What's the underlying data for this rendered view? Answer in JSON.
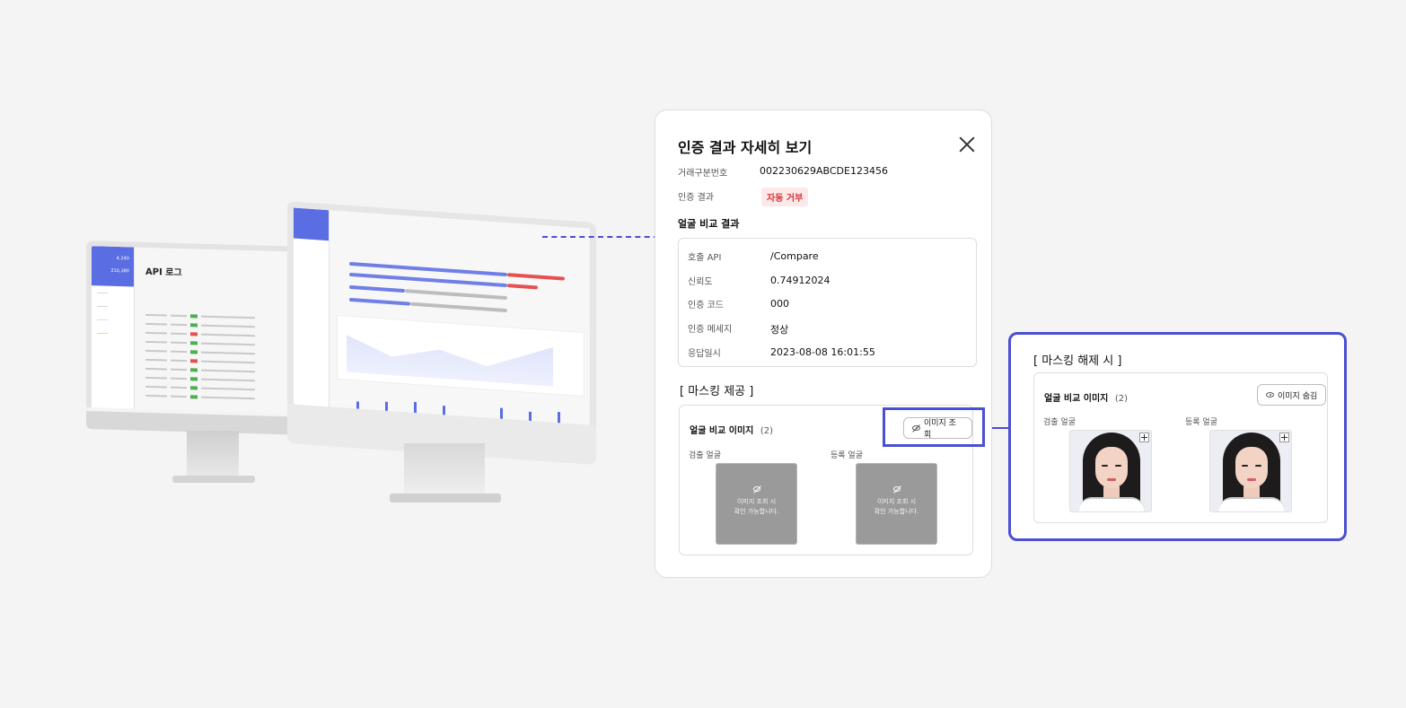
{
  "back_screen": {
    "title": "API 로그",
    "side_card": "4,240",
    "side_amount": "210,380"
  },
  "panel": {
    "title": "인증 결과 자세히 보기",
    "fields": [
      {
        "label": "거래구분번호",
        "value": "002230629ABCDE123456"
      },
      {
        "label": "인증 결과",
        "value": "자동 거부"
      }
    ],
    "face_result": {
      "title": "얼굴 비교 결과",
      "rows": [
        {
          "label": "호출 API",
          "value": "/Compare"
        },
        {
          "label": "신뢰도",
          "value": "0.74912024"
        },
        {
          "label": "인증 코드",
          "value": "000"
        },
        {
          "label": "인증 메세지",
          "value": "정상"
        },
        {
          "label": "응답일시",
          "value": "2023-08-08 16:01:55"
        }
      ]
    },
    "masking": {
      "title": "[ 마스킹 제공 ]",
      "images_label": "얼굴 비교 이미지",
      "images_count": "(2)",
      "view_button": "이미지 조회",
      "detected_label": "검출 얼굴",
      "registered_label": "등록 얼굴",
      "masked_text_1": "이미지 조회 시",
      "masked_text_2": "확인 가능합니다."
    }
  },
  "callout": {
    "title": "[ 마스킹 해제 시 ]",
    "images_label": "얼굴 비교 이미지",
    "images_count": "(2)",
    "hide_button": "이미지 숨김",
    "detected_label": "검출 얼굴",
    "registered_label": "등록 얼굴"
  },
  "colors": {
    "accent": "#4b4fd1",
    "brand_blue": "#5a6de3",
    "reject_red": "#d9373b",
    "reject_bg": "#fde8e8"
  }
}
